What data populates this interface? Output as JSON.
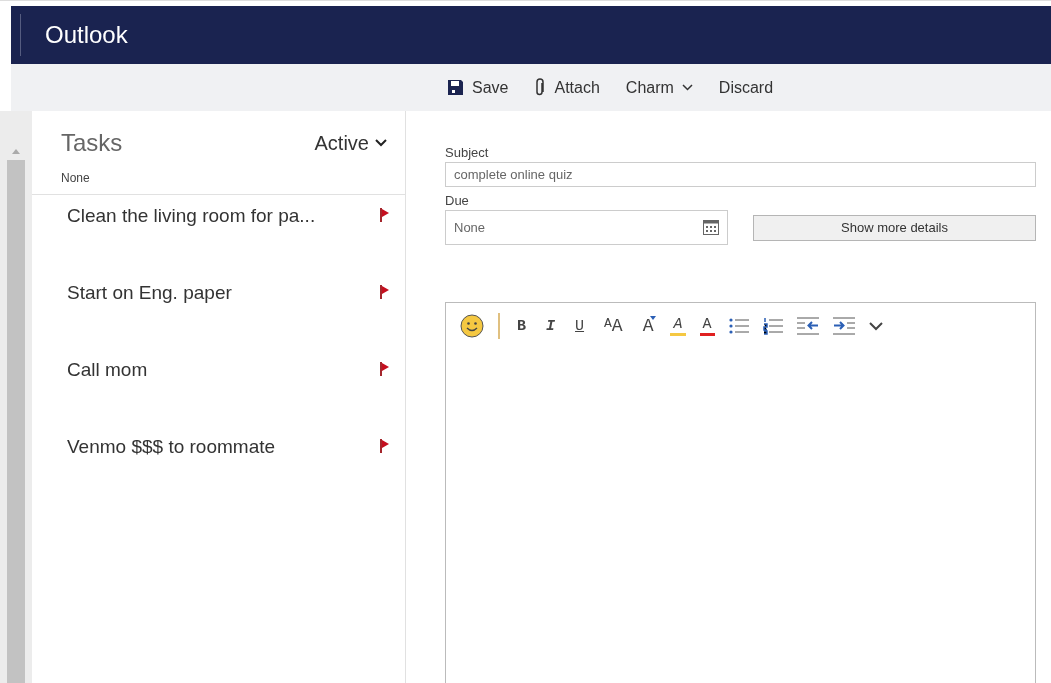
{
  "app": {
    "title": "Outlook"
  },
  "toolbar": [
    {
      "kind": "save",
      "label": "Save"
    },
    {
      "kind": "attach",
      "label": "Attach"
    },
    {
      "kind": "menu",
      "label": "Charm"
    },
    {
      "kind": "plain",
      "label": "Discard"
    }
  ],
  "tasks": {
    "title": "Tasks",
    "filter": "Active",
    "group": "None",
    "items": [
      {
        "title": "Clean the living room for pa...",
        "flagged": true
      },
      {
        "title": "Start on Eng. paper",
        "flagged": true
      },
      {
        "title": "Call mom",
        "flagged": true
      },
      {
        "title": "Venmo $$$ to roommate",
        "flagged": true
      }
    ]
  },
  "form": {
    "subject_label": "Subject",
    "subject": "complete online quiz",
    "due_label": "Due",
    "due": "None",
    "details_button": "Show more details"
  },
  "editor_toolbar": [
    {
      "kind": "emoji"
    },
    {
      "kind": "divider"
    },
    {
      "kind": "bold",
      "label": "B"
    },
    {
      "kind": "italic",
      "label": "I"
    },
    {
      "kind": "underline",
      "label": "U"
    },
    {
      "kind": "size",
      "label": "A",
      "label2": "A"
    },
    {
      "kind": "grow",
      "label": "A"
    },
    {
      "kind": "highlight",
      "label": "A"
    },
    {
      "kind": "color",
      "label": "A"
    },
    {
      "kind": "bullets"
    },
    {
      "kind": "numbering"
    },
    {
      "kind": "outdent"
    },
    {
      "kind": "indent"
    },
    {
      "kind": "more"
    }
  ]
}
